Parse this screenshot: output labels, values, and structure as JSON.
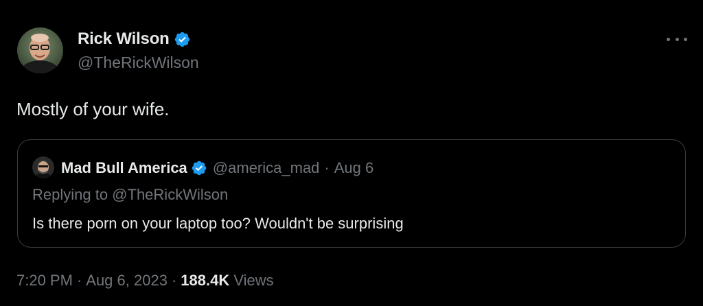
{
  "tweet": {
    "author": {
      "name": "Rick Wilson",
      "handle": "@TheRickWilson",
      "verified": true
    },
    "text": "Mostly of your wife.",
    "more_icon": "more-horizontal-icon",
    "time": "7:20 PM",
    "date": "Aug 6, 2023",
    "views_count": "188.4K",
    "views_label": "Views",
    "separator": "·"
  },
  "quoted": {
    "author": {
      "name": "Mad Bull America",
      "handle": "@america_mad",
      "verified": true
    },
    "date": "Aug 6",
    "separator": "·",
    "replying_to": "Replying to @TheRickWilson",
    "text": "Is there porn on your laptop too? Wouldn't be surprising"
  },
  "colors": {
    "background": "#000000",
    "primary_text": "#e7e9ea",
    "secondary_text": "#71767b",
    "verified_badge": "#1d9bf0",
    "quote_border": "#3a3e42"
  }
}
